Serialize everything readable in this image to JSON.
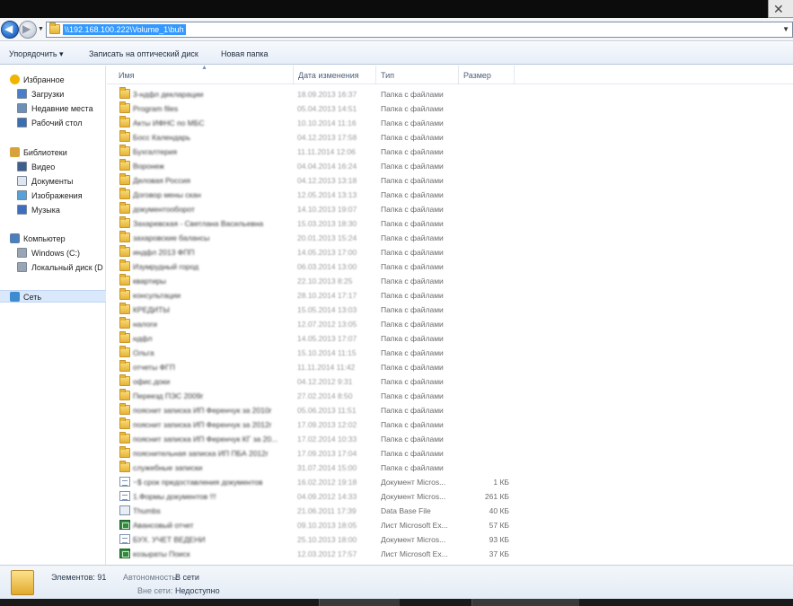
{
  "window": {
    "close_glyph": "✕"
  },
  "nav_buttons": {
    "back_icon": "arrow-left-icon",
    "back_glyph": "◀",
    "forward_icon": "arrow-right-icon",
    "forward_glyph": "▶"
  },
  "address": {
    "path": "\\\\192.168.100.222\\Volume_1\\buh"
  },
  "toolbar": {
    "organize_label": "Упорядочить ▾",
    "burn_label": "Записать на оптический диск",
    "new_folder_label": "Новая папка"
  },
  "nav": {
    "favorites": {
      "label": "Избранное",
      "icon": "star-icon",
      "items": [
        {
          "label": "Загрузки",
          "icon": "downloads-icon"
        },
        {
          "label": "Недавние места",
          "icon": "recent-places-icon"
        },
        {
          "label": "Рабочий стол",
          "icon": "desktop-icon"
        }
      ]
    },
    "libraries": {
      "label": "Библиотеки",
      "icon": "libraries-icon",
      "items": [
        {
          "label": "Видео",
          "icon": "video-icon"
        },
        {
          "label": "Документы",
          "icon": "documents-icon"
        },
        {
          "label": "Изображения",
          "icon": "pictures-icon"
        },
        {
          "label": "Музыка",
          "icon": "music-icon"
        }
      ]
    },
    "computer": {
      "label": "Компьютер",
      "icon": "computer-icon",
      "items": [
        {
          "label": "Windows (C:)",
          "icon": "drive-icon"
        },
        {
          "label": "Локальный диск (D",
          "icon": "drive-icon"
        }
      ]
    },
    "network": {
      "label": "Сеть",
      "icon": "network-icon"
    }
  },
  "columns": {
    "name": "Имя",
    "date": "Дата изменения",
    "type": "Тип",
    "size": "Размер"
  },
  "files": [
    {
      "name": "3-ндфл декларации",
      "date": "18.09.2013 16:37",
      "type": "Папка с файлами",
      "size": "",
      "icon": "folder"
    },
    {
      "name": "Program files",
      "date": "05.04.2013 14:51",
      "type": "Папка с файлами",
      "size": "",
      "icon": "folder"
    },
    {
      "name": "Акты ИФНС по МБС",
      "date": "10.10.2014 11:16",
      "type": "Папка с файлами",
      "size": "",
      "icon": "folder"
    },
    {
      "name": "Босс Календарь",
      "date": "04.12.2013 17:58",
      "type": "Папка с файлами",
      "size": "",
      "icon": "folder"
    },
    {
      "name": "Бухгалтерия",
      "date": "11.11.2014 12:06",
      "type": "Папка с файлами",
      "size": "",
      "icon": "folder"
    },
    {
      "name": "Воронеж",
      "date": "04.04.2014 16:24",
      "type": "Папка с файлами",
      "size": "",
      "icon": "folder"
    },
    {
      "name": "Деловая Россия",
      "date": "04.12.2013 13:18",
      "type": "Папка с файлами",
      "size": "",
      "icon": "folder"
    },
    {
      "name": "Договор мены скан",
      "date": "12.05.2014 13:13",
      "type": "Папка с файлами",
      "size": "",
      "icon": "folder"
    },
    {
      "name": "документооборот",
      "date": "14.10.2013 19:07",
      "type": "Папка с файлами",
      "size": "",
      "icon": "folder"
    },
    {
      "name": "Захаревская - Светлана Васильевна",
      "date": "15.03.2013 18:30",
      "type": "Папка с файлами",
      "size": "",
      "icon": "folder"
    },
    {
      "name": "захаровские балансы",
      "date": "20.01.2013 15:24",
      "type": "Папка с файлами",
      "size": "",
      "icon": "folder"
    },
    {
      "name": "индфл 2013 ФПП",
      "date": "14.05.2013 17:00",
      "type": "Папка с файлами",
      "size": "",
      "icon": "folder"
    },
    {
      "name": "Изумрудный город",
      "date": "06.03.2014 13:00",
      "type": "Папка с файлами",
      "size": "",
      "icon": "folder"
    },
    {
      "name": "квартиры",
      "date": "22.10.2013 8:25",
      "type": "Папка с файлами",
      "size": "",
      "icon": "folder"
    },
    {
      "name": "консультации",
      "date": "28.10.2014 17:17",
      "type": "Папка с файлами",
      "size": "",
      "icon": "folder"
    },
    {
      "name": "КРЕДИТЫ",
      "date": "15.05.2014 13:03",
      "type": "Папка с файлами",
      "size": "",
      "icon": "folder"
    },
    {
      "name": "налоги",
      "date": "12.07.2012 13:05",
      "type": "Папка с файлами",
      "size": "",
      "icon": "folder"
    },
    {
      "name": "ндфл",
      "date": "14.05.2013 17:07",
      "type": "Папка с файлами",
      "size": "",
      "icon": "folder"
    },
    {
      "name": "Ольга",
      "date": "15.10.2014 11:15",
      "type": "Папка с файлами",
      "size": "",
      "icon": "folder"
    },
    {
      "name": "отчеты ФГП",
      "date": "11.11.2014 11:42",
      "type": "Папка с файлами",
      "size": "",
      "icon": "folder"
    },
    {
      "name": "офис.доки",
      "date": "04.12.2012 9:31",
      "type": "Папка с файлами",
      "size": "",
      "icon": "folder"
    },
    {
      "name": "Переезд ПЭС 2009г",
      "date": "27.02.2014 8:50",
      "type": "Папка с файлами",
      "size": "",
      "icon": "folder"
    },
    {
      "name": "пояснит записка ИП Ференчук за 2010г",
      "date": "05.06.2013 11:51",
      "type": "Папка с файлами",
      "size": "",
      "icon": "folder"
    },
    {
      "name": "пояснит записка ИП Ференчук за 2012г",
      "date": "17.09.2013 12:02",
      "type": "Папка с файлами",
      "size": "",
      "icon": "folder"
    },
    {
      "name": "пояснит записка ИП Ференчук КГ за 20...",
      "date": "17.02.2014 10:33",
      "type": "Папка с файлами",
      "size": "",
      "icon": "folder"
    },
    {
      "name": "пояснительная записка ИП ПБА 2012г",
      "date": "17.09.2013 17:04",
      "type": "Папка с файлами",
      "size": "",
      "icon": "folder"
    },
    {
      "name": "служебные записки",
      "date": "31.07.2014 15:00",
      "type": "Папка с файлами",
      "size": "",
      "icon": "folder"
    },
    {
      "name": "~$ срок предоставления документов",
      "date": "16.02.2012 19:18",
      "type": "Документ Micros...",
      "size": "1 КБ",
      "icon": "doc"
    },
    {
      "name": "1.Формы документов !!!",
      "date": "04.09.2012 14:33",
      "type": "Документ Micros...",
      "size": "261 КБ",
      "icon": "doc"
    },
    {
      "name": "Thumbs",
      "date": "21.06.2011 17:39",
      "type": "Data Base File",
      "size": "40 КБ",
      "icon": "db"
    },
    {
      "name": "Авансовый отчет",
      "date": "09.10.2013 18:05",
      "type": "Лист Microsoft Ex...",
      "size": "57 КБ",
      "icon": "xls"
    },
    {
      "name": "БУХ. УЧЕТ ВЕДЕНИ",
      "date": "25.10.2013 18:00",
      "type": "Документ Micros...",
      "size": "93 КБ",
      "icon": "doc"
    },
    {
      "name": "козыраты Поиск",
      "date": "12.03.2012 17:57",
      "type": "Лист Microsoft Ex...",
      "size": "37 КБ",
      "icon": "xls"
    }
  ],
  "status": {
    "count": "Элементов: 91",
    "offline_label": "Автономность:",
    "offline_value": "В сети",
    "availability_label": "Вне сети:",
    "availability_value": "Недоступно",
    "icon": "folder-icon"
  }
}
